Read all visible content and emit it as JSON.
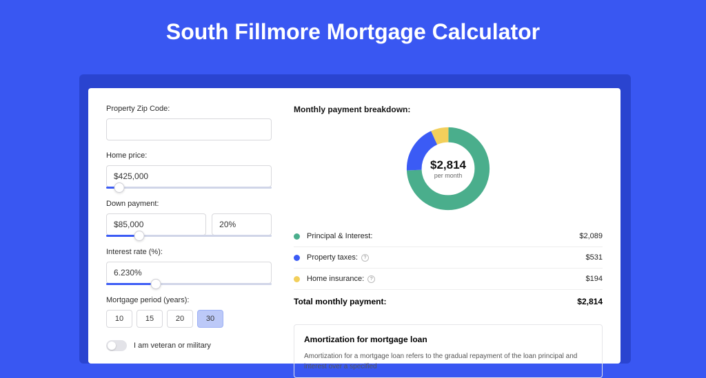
{
  "page_title": "South Fillmore Mortgage Calculator",
  "form": {
    "zip_label": "Property Zip Code:",
    "zip_value": "",
    "home_price_label": "Home price:",
    "home_price_value": "$425,000",
    "home_price_slider_pct": 8,
    "down_payment_label": "Down payment:",
    "down_payment_value": "$85,000",
    "down_payment_pct_value": "20%",
    "down_payment_slider_pct": 20,
    "interest_label": "Interest rate (%):",
    "interest_value": "6.230%",
    "interest_slider_pct": 30,
    "period_label": "Mortgage period (years):",
    "period_options": [
      "10",
      "15",
      "20",
      "30"
    ],
    "period_selected": "30",
    "veteran_label": "I am veteran or military"
  },
  "breakdown": {
    "title": "Monthly payment breakdown:",
    "center_value": "$2,814",
    "center_sub": "per month",
    "items": [
      {
        "label": "Principal & Interest:",
        "value": "$2,089",
        "color": "#4aae8c",
        "amount": 2089,
        "info": false
      },
      {
        "label": "Property taxes:",
        "value": "$531",
        "color": "#3b5bf5",
        "amount": 531,
        "info": true
      },
      {
        "label": "Home insurance:",
        "value": "$194",
        "color": "#f2cf5b",
        "amount": 194,
        "info": true
      }
    ],
    "total_label": "Total monthly payment:",
    "total_value": "$2,814"
  },
  "amortization": {
    "title": "Amortization for mortgage loan",
    "text": "Amortization for a mortgage loan refers to the gradual repayment of the loan principal and interest over a specified"
  },
  "chart_data": {
    "type": "pie",
    "title": "Monthly payment breakdown",
    "series": [
      {
        "name": "Principal & Interest",
        "value": 2089,
        "color": "#4aae8c"
      },
      {
        "name": "Property taxes",
        "value": 531,
        "color": "#3b5bf5"
      },
      {
        "name": "Home insurance",
        "value": 194,
        "color": "#f2cf5b"
      }
    ],
    "total": 2814,
    "center_label": "$2,814 per month"
  }
}
